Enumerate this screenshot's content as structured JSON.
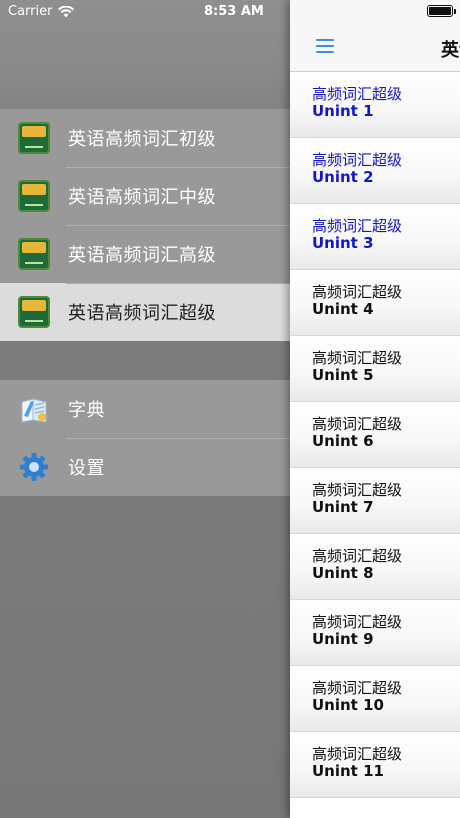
{
  "status_bar": {
    "carrier": "Carrier",
    "time": "8:53 AM"
  },
  "drawer": {
    "levels": [
      {
        "label": "英语高频词汇初级",
        "icon": "word-card-book-icon",
        "selected": false
      },
      {
        "label": "英语高频词汇中级",
        "icon": "word-card-book-icon",
        "selected": false
      },
      {
        "label": "英语高频词汇高级",
        "icon": "word-card-book-icon",
        "selected": false
      },
      {
        "label": "英语高频词汇超级",
        "icon": "word-card-book-icon",
        "selected": true
      }
    ],
    "tools": [
      {
        "label": "字典",
        "icon": "dictionary-icon"
      },
      {
        "label": "设置",
        "icon": "gear-icon"
      }
    ]
  },
  "panel": {
    "title": "英语高频词汇超级",
    "menu_icon": "hamburger-menu-icon",
    "units": [
      {
        "title": "高频词汇超级",
        "unit": "Unint 1",
        "completed": true
      },
      {
        "title": "高频词汇超级",
        "unit": "Unint 2",
        "completed": true
      },
      {
        "title": "高频词汇超级",
        "unit": "Unint 3",
        "completed": true
      },
      {
        "title": "高频词汇超级",
        "unit": "Unint 4",
        "completed": false
      },
      {
        "title": "高频词汇超级",
        "unit": "Unint 5",
        "completed": false
      },
      {
        "title": "高频词汇超级",
        "unit": "Unint 6",
        "completed": false
      },
      {
        "title": "高频词汇超级",
        "unit": "Unint 7",
        "completed": false
      },
      {
        "title": "高频词汇超级",
        "unit": "Unint 8",
        "completed": false
      },
      {
        "title": "高频词汇超级",
        "unit": "Unint 9",
        "completed": false
      },
      {
        "title": "高频词汇超级",
        "unit": "Unint 10",
        "completed": false
      },
      {
        "title": "高频词汇超级",
        "unit": "Unint 11",
        "completed": false
      }
    ]
  },
  "colors": {
    "accent": "#3a8ee6",
    "completed_text": "#1515cc",
    "selected_row": "#dcdcdc"
  }
}
